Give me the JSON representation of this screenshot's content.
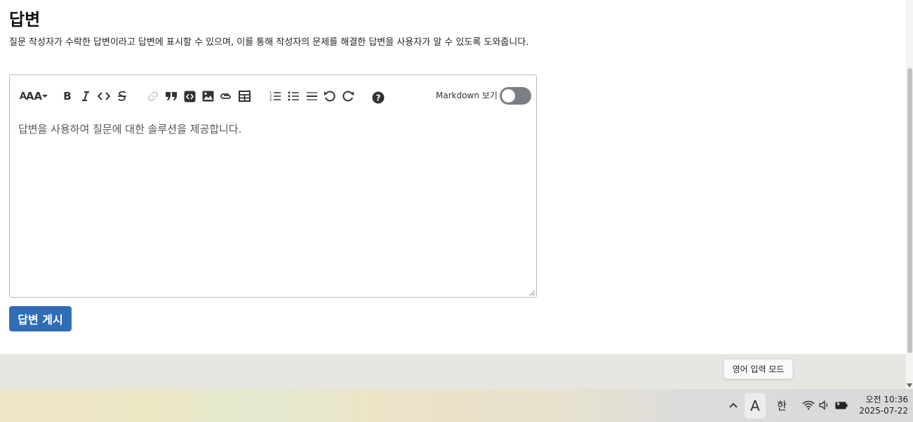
{
  "section": {
    "title": "답변",
    "description": "질문 작성자가 수락한 답변이라고 답변에 표시할 수 있으며, 이를 통해 작성자의 문제를 해결한 답변을 사용자가 알 수 있도록 도와줍니다."
  },
  "editor": {
    "toolbar": {
      "font_size_label": "AA",
      "bold_label": "B",
      "icons": [
        "font-size-icon",
        "dropdown-caret-icon",
        "bold-icon",
        "italic-icon",
        "code-icon",
        "strikethrough-icon",
        "link-icon",
        "blockquote-icon",
        "code-block-icon",
        "image-icon",
        "attachment-icon",
        "table-icon",
        "ordered-list-icon",
        "unordered-list-icon",
        "horizontal-rule-icon",
        "undo-icon",
        "redo-icon",
        "help-icon"
      ],
      "markdown_toggle_label": "Markdown 보기",
      "markdown_toggle_on": false
    },
    "placeholder": "답변을 사용하여 질문에 대한 솔루션을 제공합니다."
  },
  "submit_button": {
    "label": "답변 게시"
  },
  "colors": {
    "primary": "#2f6db5",
    "toggle_off": "#7a7f86"
  },
  "tooltip": {
    "text": "영어 입력 모드"
  },
  "taskbar": {
    "ime_mode": "A",
    "ime_korean": "한",
    "time": "오전 10:36",
    "date": "2025-07-22"
  }
}
